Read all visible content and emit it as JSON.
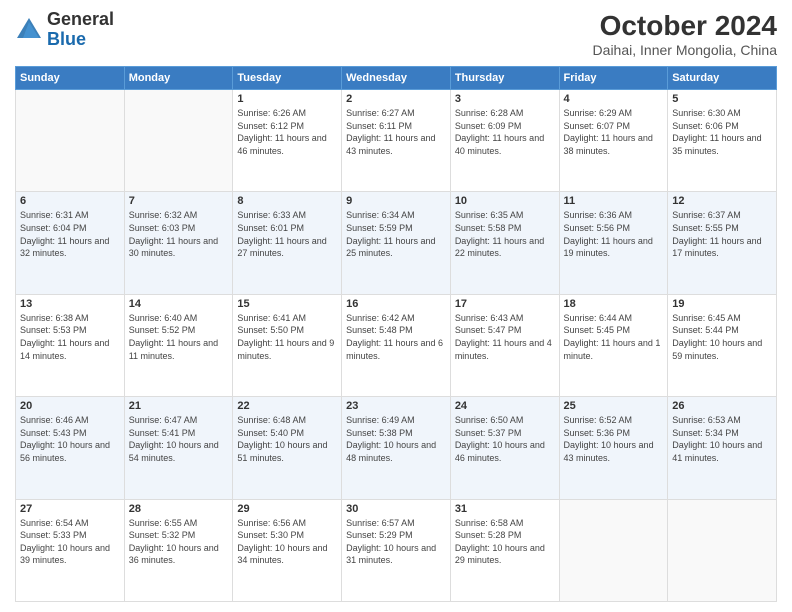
{
  "header": {
    "logo_general": "General",
    "logo_blue": "Blue",
    "title": "October 2024",
    "subtitle": "Daihai, Inner Mongolia, China"
  },
  "calendar": {
    "days_of_week": [
      "Sunday",
      "Monday",
      "Tuesday",
      "Wednesday",
      "Thursday",
      "Friday",
      "Saturday"
    ],
    "weeks": [
      [
        {
          "day": "",
          "info": ""
        },
        {
          "day": "",
          "info": ""
        },
        {
          "day": "1",
          "info": "Sunrise: 6:26 AM\nSunset: 6:12 PM\nDaylight: 11 hours and 46 minutes."
        },
        {
          "day": "2",
          "info": "Sunrise: 6:27 AM\nSunset: 6:11 PM\nDaylight: 11 hours and 43 minutes."
        },
        {
          "day": "3",
          "info": "Sunrise: 6:28 AM\nSunset: 6:09 PM\nDaylight: 11 hours and 40 minutes."
        },
        {
          "day": "4",
          "info": "Sunrise: 6:29 AM\nSunset: 6:07 PM\nDaylight: 11 hours and 38 minutes."
        },
        {
          "day": "5",
          "info": "Sunrise: 6:30 AM\nSunset: 6:06 PM\nDaylight: 11 hours and 35 minutes."
        }
      ],
      [
        {
          "day": "6",
          "info": "Sunrise: 6:31 AM\nSunset: 6:04 PM\nDaylight: 11 hours and 32 minutes."
        },
        {
          "day": "7",
          "info": "Sunrise: 6:32 AM\nSunset: 6:03 PM\nDaylight: 11 hours and 30 minutes."
        },
        {
          "day": "8",
          "info": "Sunrise: 6:33 AM\nSunset: 6:01 PM\nDaylight: 11 hours and 27 minutes."
        },
        {
          "day": "9",
          "info": "Sunrise: 6:34 AM\nSunset: 5:59 PM\nDaylight: 11 hours and 25 minutes."
        },
        {
          "day": "10",
          "info": "Sunrise: 6:35 AM\nSunset: 5:58 PM\nDaylight: 11 hours and 22 minutes."
        },
        {
          "day": "11",
          "info": "Sunrise: 6:36 AM\nSunset: 5:56 PM\nDaylight: 11 hours and 19 minutes."
        },
        {
          "day": "12",
          "info": "Sunrise: 6:37 AM\nSunset: 5:55 PM\nDaylight: 11 hours and 17 minutes."
        }
      ],
      [
        {
          "day": "13",
          "info": "Sunrise: 6:38 AM\nSunset: 5:53 PM\nDaylight: 11 hours and 14 minutes."
        },
        {
          "day": "14",
          "info": "Sunrise: 6:40 AM\nSunset: 5:52 PM\nDaylight: 11 hours and 11 minutes."
        },
        {
          "day": "15",
          "info": "Sunrise: 6:41 AM\nSunset: 5:50 PM\nDaylight: 11 hours and 9 minutes."
        },
        {
          "day": "16",
          "info": "Sunrise: 6:42 AM\nSunset: 5:48 PM\nDaylight: 11 hours and 6 minutes."
        },
        {
          "day": "17",
          "info": "Sunrise: 6:43 AM\nSunset: 5:47 PM\nDaylight: 11 hours and 4 minutes."
        },
        {
          "day": "18",
          "info": "Sunrise: 6:44 AM\nSunset: 5:45 PM\nDaylight: 11 hours and 1 minute."
        },
        {
          "day": "19",
          "info": "Sunrise: 6:45 AM\nSunset: 5:44 PM\nDaylight: 10 hours and 59 minutes."
        }
      ],
      [
        {
          "day": "20",
          "info": "Sunrise: 6:46 AM\nSunset: 5:43 PM\nDaylight: 10 hours and 56 minutes."
        },
        {
          "day": "21",
          "info": "Sunrise: 6:47 AM\nSunset: 5:41 PM\nDaylight: 10 hours and 54 minutes."
        },
        {
          "day": "22",
          "info": "Sunrise: 6:48 AM\nSunset: 5:40 PM\nDaylight: 10 hours and 51 minutes."
        },
        {
          "day": "23",
          "info": "Sunrise: 6:49 AM\nSunset: 5:38 PM\nDaylight: 10 hours and 48 minutes."
        },
        {
          "day": "24",
          "info": "Sunrise: 6:50 AM\nSunset: 5:37 PM\nDaylight: 10 hours and 46 minutes."
        },
        {
          "day": "25",
          "info": "Sunrise: 6:52 AM\nSunset: 5:36 PM\nDaylight: 10 hours and 43 minutes."
        },
        {
          "day": "26",
          "info": "Sunrise: 6:53 AM\nSunset: 5:34 PM\nDaylight: 10 hours and 41 minutes."
        }
      ],
      [
        {
          "day": "27",
          "info": "Sunrise: 6:54 AM\nSunset: 5:33 PM\nDaylight: 10 hours and 39 minutes."
        },
        {
          "day": "28",
          "info": "Sunrise: 6:55 AM\nSunset: 5:32 PM\nDaylight: 10 hours and 36 minutes."
        },
        {
          "day": "29",
          "info": "Sunrise: 6:56 AM\nSunset: 5:30 PM\nDaylight: 10 hours and 34 minutes."
        },
        {
          "day": "30",
          "info": "Sunrise: 6:57 AM\nSunset: 5:29 PM\nDaylight: 10 hours and 31 minutes."
        },
        {
          "day": "31",
          "info": "Sunrise: 6:58 AM\nSunset: 5:28 PM\nDaylight: 10 hours and 29 minutes."
        },
        {
          "day": "",
          "info": ""
        },
        {
          "day": "",
          "info": ""
        }
      ]
    ]
  }
}
